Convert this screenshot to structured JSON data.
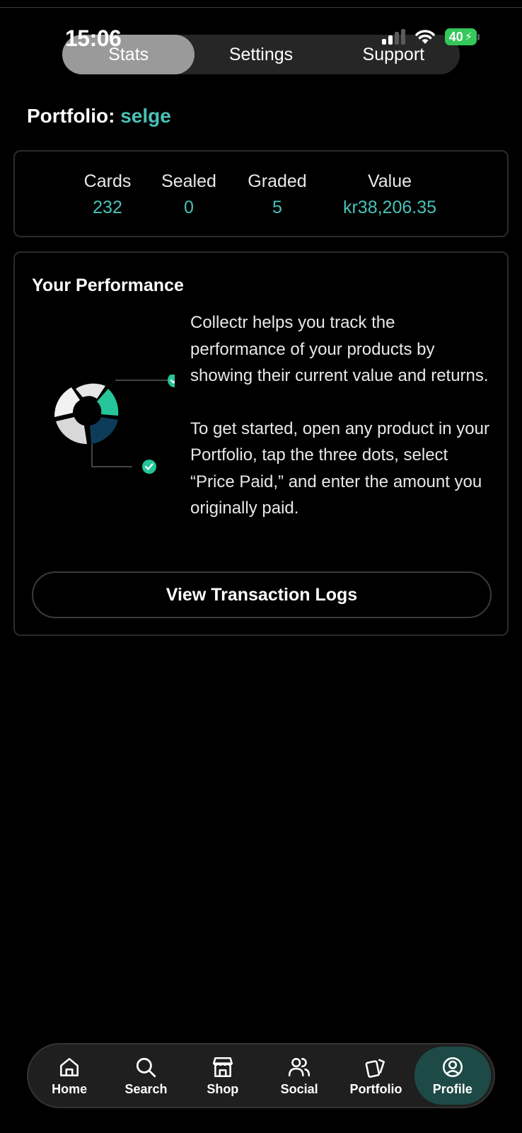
{
  "status_bar": {
    "time": "15:06",
    "battery": "40"
  },
  "tabs": [
    {
      "label": "Stats",
      "active": true
    },
    {
      "label": "Settings",
      "active": false
    },
    {
      "label": "Support",
      "active": false
    }
  ],
  "portfolio": {
    "prefix": "Portfolio: ",
    "name": "selge"
  },
  "stats": [
    {
      "label": "Cards",
      "value": "232"
    },
    {
      "label": "Sealed",
      "value": "0"
    },
    {
      "label": "Graded",
      "value": "5"
    },
    {
      "label": "Value",
      "value": "kr38,206.35"
    }
  ],
  "performance": {
    "title": "Your Performance",
    "paragraph1": "Collectr helps you track the performance of your products by showing their current value and returns.",
    "paragraph2": "To get started, open any product in your Portfolio, tap the three dots, select “Price Paid,” and enter the amount you originally paid.",
    "button_label": "View Transaction Logs"
  },
  "bottom_nav": [
    {
      "label": "Home",
      "icon": "home-icon",
      "active": false
    },
    {
      "label": "Search",
      "icon": "search-icon",
      "active": false
    },
    {
      "label": "Shop",
      "icon": "shop-icon",
      "active": false
    },
    {
      "label": "Social",
      "icon": "social-icon",
      "active": false
    },
    {
      "label": "Portfolio",
      "icon": "cards-icon",
      "active": false
    },
    {
      "label": "Profile",
      "icon": "profile-icon",
      "active": true
    }
  ],
  "colors": {
    "accent": "#48c2b8",
    "active_nav_bg": "#1d4a46",
    "battery": "#34c759"
  }
}
